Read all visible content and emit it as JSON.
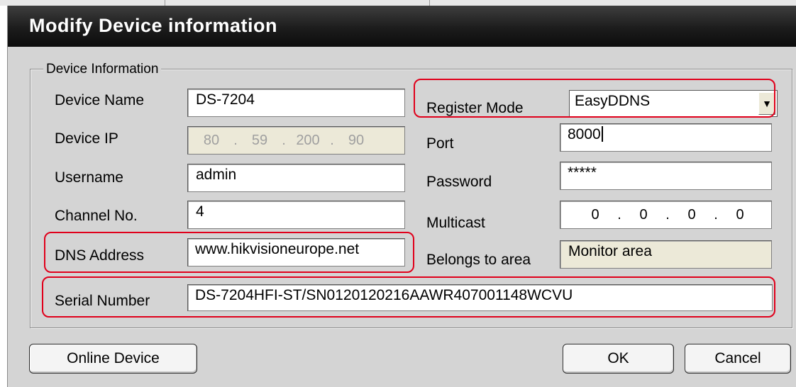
{
  "dialog": {
    "title": "Modify Device information"
  },
  "group": {
    "legend": "Device Information"
  },
  "fields": {
    "device_name": {
      "label": "Device Name",
      "value": "DS-7204"
    },
    "device_ip": {
      "label": "Device IP",
      "octets": [
        "80",
        "59",
        "200",
        "90"
      ]
    },
    "username": {
      "label": "Username",
      "value": "admin"
    },
    "channel_no": {
      "label": "Channel No.",
      "value": "4"
    },
    "dns_address": {
      "label": "DNS Address",
      "value": "www.hikvisioneurope.net"
    },
    "serial_number": {
      "label": "Serial Number",
      "value": "DS-7204HFI-ST/SN0120120216AAWR407001148WCVU"
    },
    "register_mode": {
      "label": "Register Mode",
      "value": "EasyDDNS"
    },
    "port": {
      "label": "Port",
      "value": "8000"
    },
    "password": {
      "label": "Password",
      "value": "*****"
    },
    "multicast": {
      "label": "Multicast",
      "octets": [
        "0",
        "0",
        "0",
        "0"
      ]
    },
    "belongs_to_area": {
      "label": "Belongs to area",
      "value": "Monitor area"
    }
  },
  "buttons": {
    "online_device": "Online Device",
    "ok": "OK",
    "cancel": "Cancel"
  },
  "icons": {
    "dropdown_arrow": "chevron-down-icon"
  },
  "colors": {
    "highlight": "#e0001b",
    "titlebar": "#1c1c1c",
    "panel": "#d4d4d4"
  }
}
